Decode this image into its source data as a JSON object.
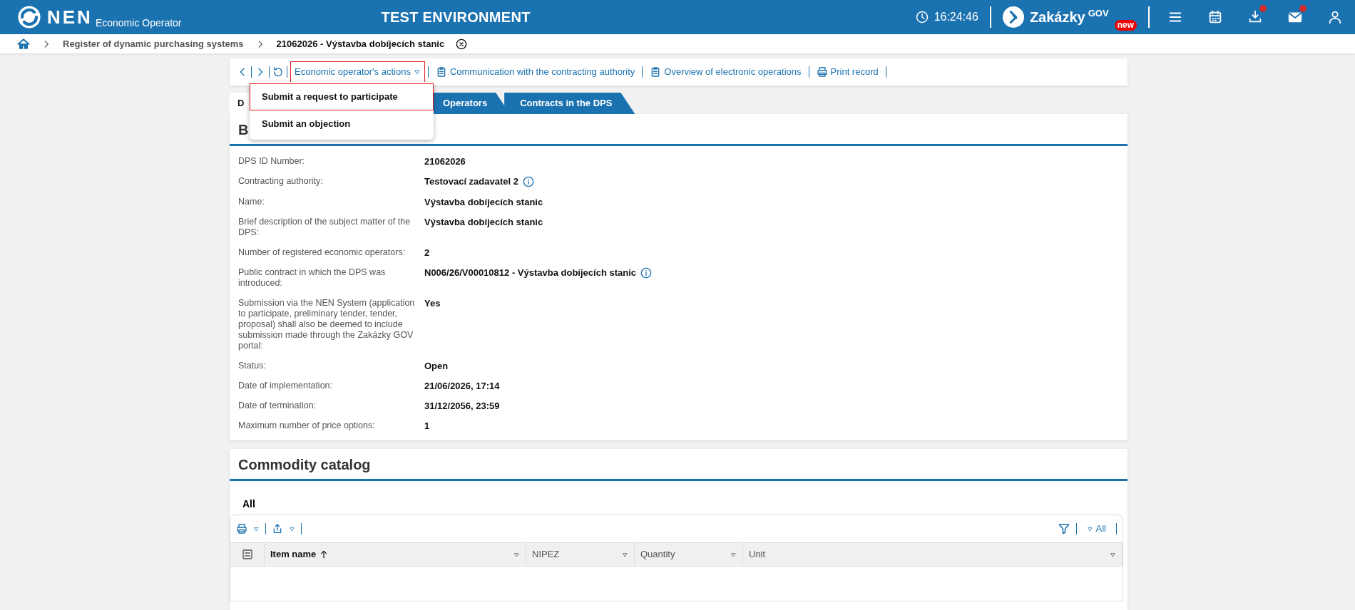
{
  "header": {
    "logo": "NEN",
    "subtitle": "Economic Operator",
    "environment": "TEST ENVIRONMENT",
    "time": "16:24:46",
    "portal": {
      "name": "Zakázky",
      "sup": "GOV",
      "badge": "new"
    },
    "icons": [
      {
        "kind": "menu",
        "notification": false
      },
      {
        "kind": "calendar",
        "notification": false
      },
      {
        "kind": "download",
        "notification": true
      },
      {
        "kind": "mail",
        "notification": true
      },
      {
        "kind": "user",
        "notification": false
      }
    ]
  },
  "breadcrumb": [
    {
      "label": "Register of dynamic purchasing systems",
      "current": false
    },
    {
      "label": "21062026 - Výstavba dobíjecích stanic",
      "current": true
    }
  ],
  "toolbar": {
    "actions": [
      {
        "label": "Economic operator's actions",
        "kind": "dropdown",
        "expanded": true
      },
      {
        "label": "Communication with the contracting authority",
        "kind": "clipboard"
      },
      {
        "label": "Overview of electronic operations",
        "kind": "clipboard"
      },
      {
        "label": "Print record",
        "kind": "print"
      }
    ]
  },
  "dropdown": {
    "items": [
      {
        "label": "Submit a request to participate",
        "selected": true
      },
      {
        "label": "Submit an objection",
        "selected": false
      }
    ]
  },
  "tabs": [
    {
      "label": "D",
      "selected": true
    },
    {
      "label": "Operators",
      "selected": false
    },
    {
      "label": "Contracts in the DPS",
      "selected": false
    }
  ],
  "details": {
    "title": "B",
    "fields": [
      {
        "label": "DPS ID Number:",
        "value": "21062026",
        "info": false
      },
      {
        "label": "Contracting authority:",
        "value": "Testovací zadavatel 2",
        "info": true
      },
      {
        "label": "Name:",
        "value": "Výstavba dobíjecích stanic",
        "info": false
      },
      {
        "label": "Brief description of the subject matter of the DPS:",
        "value": "Výstavba dobíjecích stanic",
        "info": false
      },
      {
        "label": "Number of registered economic operators:",
        "value": "2",
        "info": false
      },
      {
        "label": "Public contract in which the DPS was introduced:",
        "value": "N006/26/V00010812 - Výstavba dobíjecích stanic",
        "info": true
      },
      {
        "label": "Submission via the NEN System (application to participate, preliminary tender, tender, proposal) shall also be deemed to include submission made through the Zakázky GOV portal:",
        "value": "Yes",
        "info": false
      },
      {
        "label": "Status:",
        "value": "Open",
        "info": false
      },
      {
        "label": "Date of implementation:",
        "value": "21/06/2026, 17:14",
        "info": false
      },
      {
        "label": "Date of termination:",
        "value": "31/12/2056, 23:59",
        "info": false
      },
      {
        "label": "Maximum number of price options:",
        "value": "1",
        "info": false
      }
    ]
  },
  "catalog": {
    "title": "Commodity catalog",
    "tabs": [
      {
        "label": "All",
        "selected": true
      }
    ],
    "filter_label": "All",
    "columns": [
      {
        "label": "Item name",
        "sorted": true
      },
      {
        "label": "NIPEZ",
        "sorted": false
      },
      {
        "label": "Quantity",
        "sorted": false
      },
      {
        "label": "Unit",
        "sorted": false
      }
    ]
  }
}
